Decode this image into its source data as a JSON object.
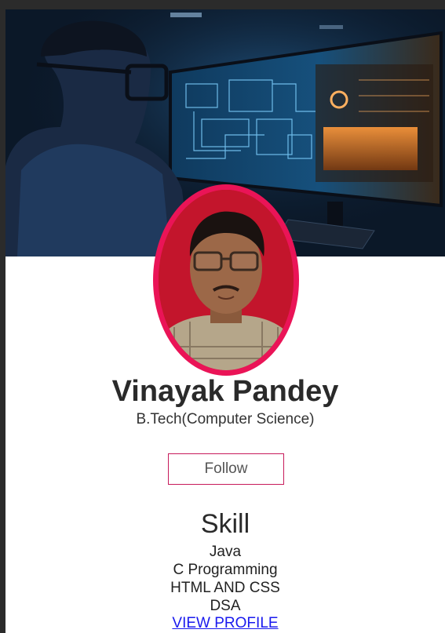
{
  "profile": {
    "name": "Vinayak Pandey",
    "degree": "B.Tech(Computer Science)"
  },
  "follow_button": {
    "label": "Follow"
  },
  "skills": {
    "title": "Skill",
    "items": [
      "Java",
      "C Programming",
      "HTML AND CSS",
      "DSA"
    ]
  },
  "view_profile": {
    "label": "VIEW PROFILE"
  },
  "colors": {
    "ring": "#ea1457",
    "button_border": "#c71a5a",
    "link": "#1a1aee"
  },
  "images": {
    "cover": "person-with-glasses-at-futuristic-monitor-photo",
    "avatar": "profile-photo-man-with-glasses"
  }
}
